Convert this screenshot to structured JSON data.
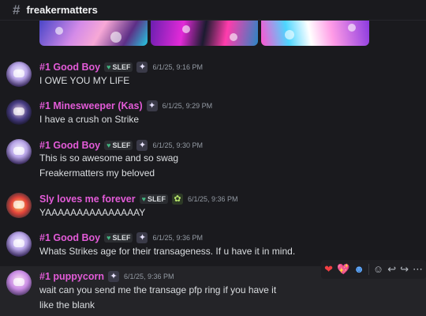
{
  "channel": {
    "name": "freakermatters",
    "icon": "hash-icon"
  },
  "messages": [
    {
      "username": "#1 Good Boy",
      "tag": "SLEF",
      "timestamp": "6/1/25, 9:16 PM",
      "lines": [
        "I OWE YOU MY LIFE"
      ]
    },
    {
      "username": "#1 Minesweeper (Kas)",
      "timestamp": "6/1/25, 9:29 PM",
      "lines": [
        "I have a crush on Strike"
      ]
    },
    {
      "username": "#1 Good Boy",
      "tag": "SLEF",
      "timestamp": "6/1/25, 9:30 PM",
      "lines": [
        "This is so awesome and so swag",
        "Freakermatters my beloved"
      ]
    },
    {
      "username": "Sly loves me forever",
      "tag": "SLEF",
      "timestamp": "6/1/25, 9:36 PM",
      "lines": [
        "YAAAAAAAAAAAAAAAY"
      ]
    },
    {
      "username": "#1 Good Boy",
      "tag": "SLEF",
      "timestamp": "6/1/25, 9:36 PM",
      "lines": [
        "Whats Strikes age for their transageness. If u have it in mind."
      ]
    },
    {
      "username": "#1 puppycorn",
      "timestamp": "6/1/25, 9:36 PM",
      "lines": [
        "wait can you send me the transage pfp ring if you have it",
        "like the blank"
      ]
    }
  ],
  "hover_actions": {
    "reactions": [
      "heart-icon",
      "sparkling-heart-icon",
      "person-icon"
    ],
    "tools": [
      "add-reaction-icon",
      "reply-icon",
      "forward-icon",
      "more-icon"
    ]
  },
  "colors": {
    "username": "#e35bd8",
    "background": "#1a1a1e",
    "tag_heart": "#43b581"
  }
}
